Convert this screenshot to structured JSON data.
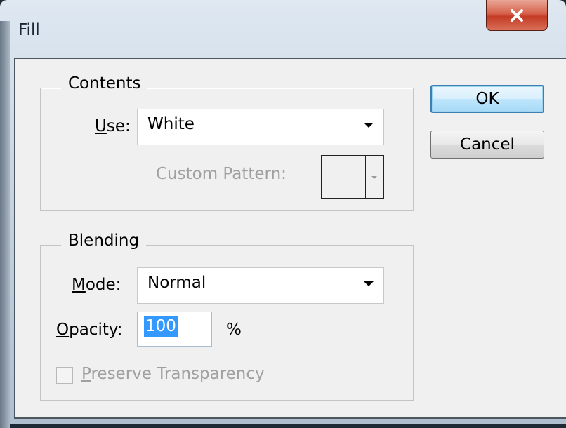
{
  "window": {
    "title": "Fill",
    "close_icon": "close-x-icon"
  },
  "contents": {
    "legend": "Contents",
    "use_label_mnemonic": "U",
    "use_label_rest": "se:",
    "use_value": "White",
    "custom_pattern_label": "Custom Pattern:"
  },
  "blending": {
    "legend": "Blending",
    "mode_label_mnemonic": "M",
    "mode_label_rest": "ode:",
    "mode_value": "Normal",
    "opacity_label_mnemonic": "O",
    "opacity_label_rest": "pacity:",
    "opacity_value": "100",
    "opacity_unit": "%",
    "preserve_label_mnemonic": "P",
    "preserve_label_rest": "reserve Transparency",
    "preserve_checked": false
  },
  "buttons": {
    "ok": "OK",
    "cancel": "Cancel"
  },
  "colors": {
    "close_red": "#c33b24",
    "default_button_border": "#3c7fb1",
    "selection_blue": "#3399ff",
    "disabled_text": "#a0a0a0"
  }
}
